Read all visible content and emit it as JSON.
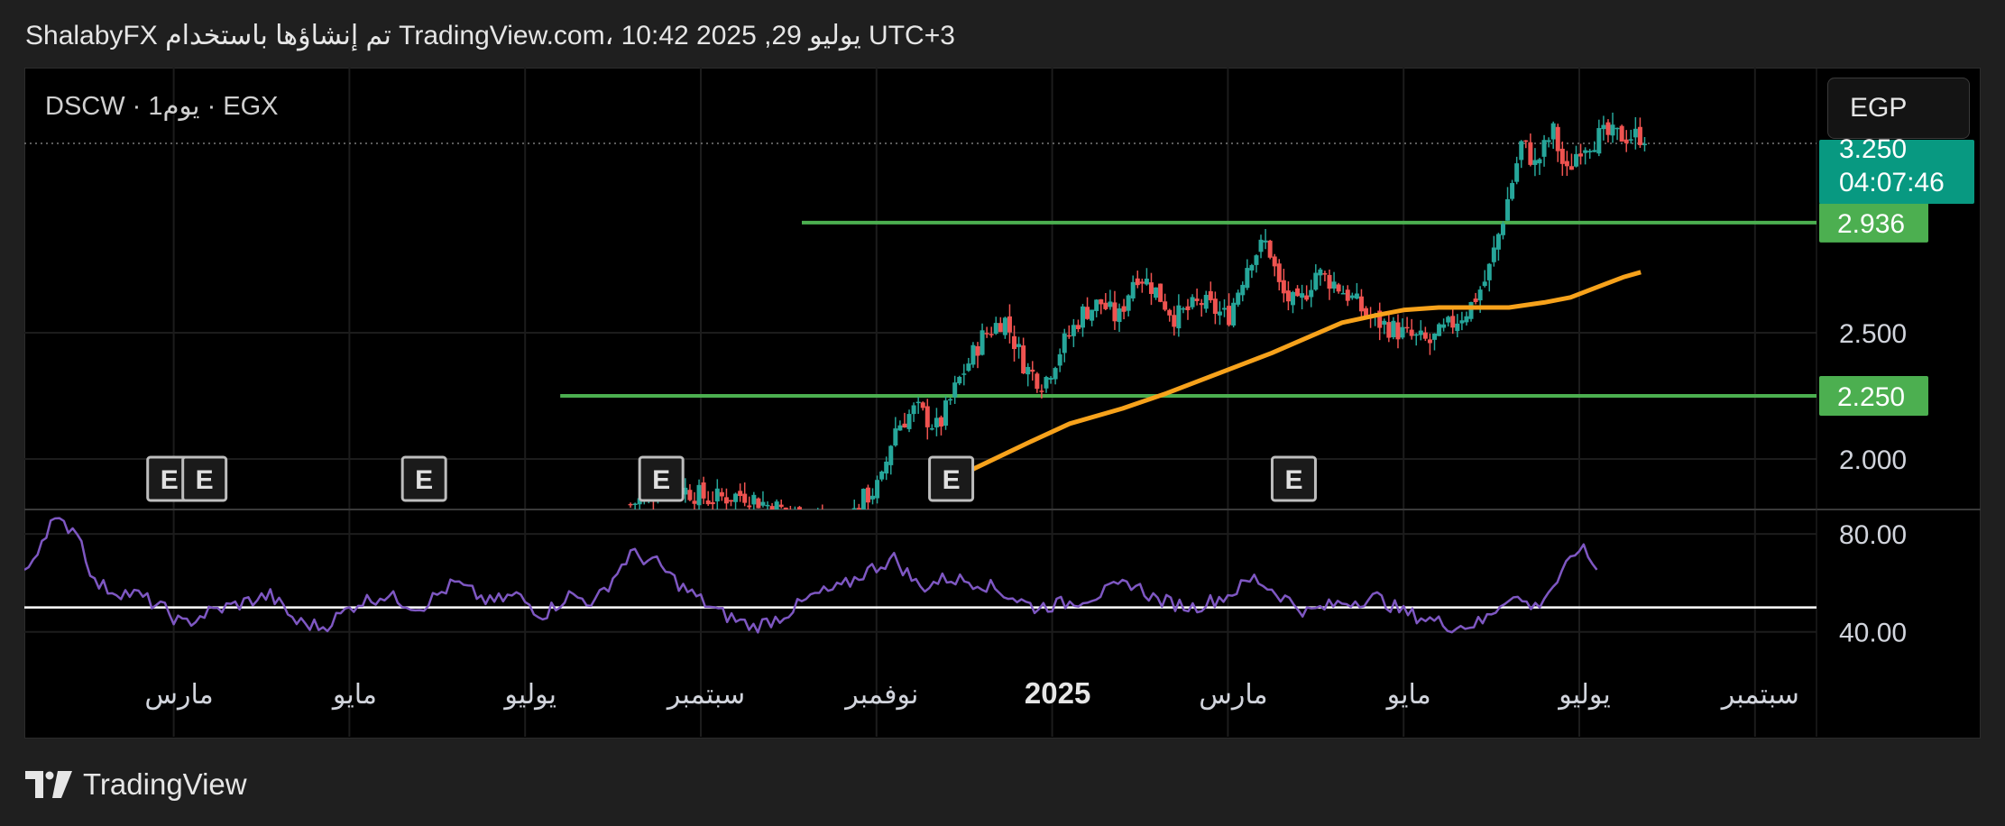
{
  "header": {
    "text": "ShalabyFX تم إنشاؤها باستخدام TradingView.com، 10:42 2025 ,29 يوليو UTC+3"
  },
  "symbol_info": {
    "text": "DSCW · 1يوم · EGX"
  },
  "currency": {
    "label": "EGP"
  },
  "footer": {
    "brand": "TradingView"
  },
  "colors": {
    "up": "#26a69a",
    "down": "#ef5350",
    "ma": "#f7a21b",
    "level": "#4caf50",
    "rsi": "#7e57c2",
    "rsi_line": "#ffffff",
    "price_tag": "#089981",
    "grid": "#1c1c1c"
  },
  "chart_data": {
    "type": "candlestick",
    "symbol": "DSCW",
    "interval": "1يوم",
    "exchange": "EGX",
    "x_tick_labels": [
      "مارس",
      "مايو",
      "يوليو",
      "سبتمبر",
      "نوفمبر",
      "2025",
      "مارس",
      "مايو",
      "يوليو",
      "سبتمبر"
    ],
    "x_ticks_fractional_month": [
      2.0,
      4.0,
      6.0,
      8.0,
      10.0,
      12.0,
      14.0,
      16.0,
      18.0,
      20.0
    ],
    "x_range_month": [
      0.3,
      20.7
    ],
    "y_tick_labels": [
      "2.000",
      "2.500"
    ],
    "y_ticks": [
      2.0,
      2.5
    ],
    "ylim": [
      1.8,
      3.55
    ],
    "last_price": {
      "value": "3.250",
      "countdown": "04:07:46"
    },
    "horizontal_levels": [
      {
        "label": "2.936",
        "value": 2.936,
        "from_month": 9.15
      },
      {
        "label": "2.250",
        "value": 2.25,
        "from_month": 6.4
      }
    ],
    "earnings_markers": [
      {
        "label": "E",
        "month": 1.95
      },
      {
        "label": "E",
        "month": 2.35
      },
      {
        "label": "E",
        "month": 4.85
      },
      {
        "label": "E",
        "month": 7.55
      },
      {
        "label": "E",
        "month": 10.85
      },
      {
        "label": "E",
        "month": 14.75
      }
    ],
    "moving_average": {
      "x_month": [
        10.6,
        11.1,
        11.7,
        12.2,
        12.8,
        13.3,
        13.9,
        14.5,
        14.9,
        15.3,
        15.7,
        16.0,
        16.4,
        16.8,
        17.2,
        17.6,
        17.9,
        18.2,
        18.5,
        18.7
      ],
      "values": [
        1.88,
        1.96,
        2.06,
        2.14,
        2.2,
        2.26,
        2.34,
        2.42,
        2.48,
        2.54,
        2.57,
        2.59,
        2.6,
        2.6,
        2.6,
        2.62,
        2.64,
        2.68,
        2.72,
        2.74
      ]
    },
    "candles": {
      "start_month": 7.2,
      "end_month": 18.75,
      "close_anchors": [
        [
          7.2,
          1.82
        ],
        [
          7.45,
          1.86
        ],
        [
          7.6,
          1.92
        ],
        [
          7.8,
          1.88
        ],
        [
          8.1,
          1.84
        ],
        [
          8.5,
          1.86
        ],
        [
          8.75,
          1.82
        ],
        [
          9.3,
          1.75
        ],
        [
          9.6,
          1.72
        ],
        [
          9.85,
          1.84
        ],
        [
          10.05,
          1.9
        ],
        [
          10.2,
          2.12
        ],
        [
          10.45,
          2.2
        ],
        [
          10.7,
          2.12
        ],
        [
          10.95,
          2.32
        ],
        [
          11.2,
          2.48
        ],
        [
          11.45,
          2.56
        ],
        [
          11.7,
          2.36
        ],
        [
          11.9,
          2.3
        ],
        [
          12.1,
          2.44
        ],
        [
          12.35,
          2.58
        ],
        [
          12.55,
          2.62
        ],
        [
          12.75,
          2.55
        ],
        [
          12.95,
          2.74
        ],
        [
          13.15,
          2.68
        ],
        [
          13.4,
          2.56
        ],
        [
          13.7,
          2.62
        ],
        [
          14.0,
          2.56
        ],
        [
          14.25,
          2.8
        ],
        [
          14.45,
          2.86
        ],
        [
          14.6,
          2.66
        ],
        [
          14.8,
          2.6
        ],
        [
          15.0,
          2.74
        ],
        [
          15.2,
          2.7
        ],
        [
          15.4,
          2.64
        ],
        [
          15.6,
          2.56
        ],
        [
          15.85,
          2.52
        ],
        [
          16.1,
          2.48
        ],
        [
          16.3,
          2.46
        ],
        [
          16.5,
          2.52
        ],
        [
          16.75,
          2.6
        ],
        [
          16.95,
          2.72
        ],
        [
          17.15,
          2.98
        ],
        [
          17.35,
          3.26
        ],
        [
          17.5,
          3.16
        ],
        [
          17.7,
          3.3
        ],
        [
          17.85,
          3.12
        ],
        [
          18.0,
          3.24
        ],
        [
          18.25,
          3.28
        ]
      ]
    },
    "rsi": {
      "y_tick_labels": [
        "80.00",
        "40.00"
      ],
      "y_ticks": [
        80,
        40
      ],
      "ylim": [
        20,
        90
      ],
      "reference_line": 50,
      "x_month": [
        0.3,
        0.6,
        0.9,
        1.1,
        1.3,
        1.6,
        1.9,
        2.1,
        2.4,
        2.8,
        3.1,
        3.4,
        3.7,
        4.1,
        4.4,
        4.8,
        5.2,
        5.6,
        5.9,
        6.2,
        6.5,
        6.8,
        7.2,
        7.5,
        7.8,
        8.2,
        8.6,
        8.9,
        9.3,
        9.6,
        9.9,
        10.2,
        10.5,
        10.8,
        11.2,
        11.5,
        11.8,
        12.2,
        12.5,
        12.9,
        13.2,
        13.6,
        14.0,
        14.3,
        14.6,
        14.9,
        15.3,
        15.7,
        16.0,
        16.3,
        16.6,
        16.9,
        17.2,
        17.5,
        17.8,
        18.0,
        18.25
      ],
      "values": [
        63,
        85,
        82,
        60,
        57,
        55,
        49,
        43,
        48,
        52,
        55,
        44,
        42,
        52,
        55,
        50,
        60,
        52,
        55,
        47,
        55,
        52,
        72,
        68,
        58,
        48,
        42,
        46,
        55,
        58,
        65,
        70,
        58,
        62,
        60,
        55,
        50,
        52,
        55,
        60,
        53,
        50,
        55,
        62,
        55,
        48,
        52,
        54,
        48,
        45,
        42,
        44,
        55,
        50,
        63,
        75,
        64
      ]
    }
  }
}
